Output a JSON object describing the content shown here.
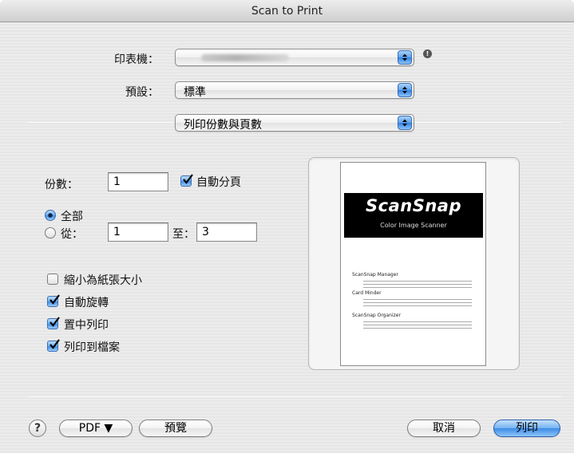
{
  "window": {
    "title": "Scan to Print"
  },
  "printer": {
    "label": "印表機：",
    "value": ""
  },
  "presets": {
    "label": "預設：",
    "value": "標準"
  },
  "section_popup": {
    "value": "列印份數與頁數"
  },
  "copies": {
    "label": "份數：",
    "value": "1",
    "collate_label": "自動分頁",
    "collate_checked": true
  },
  "pages": {
    "all_label": "全部",
    "from_label": "從：",
    "from_value": "1",
    "to_label": "至：",
    "to_value": "3",
    "selected": "all"
  },
  "options": [
    {
      "label": "縮小為紙張大小",
      "checked": false
    },
    {
      "label": "自動旋轉",
      "checked": true
    },
    {
      "label": "置中列印",
      "checked": true
    },
    {
      "label": "列印到檔案",
      "checked": true
    }
  ],
  "preview": {
    "brand": "ScanSnap",
    "subtitle": "Color Image Scanner",
    "sections": [
      "ScanSnap Manager",
      "Card Minder",
      "ScanSnap Organizer"
    ]
  },
  "buttons": {
    "help": "?",
    "pdf": "PDF ▼",
    "preview": "預覽",
    "cancel": "取消",
    "print": "列印"
  },
  "colors": {
    "accent": "#3d8ae6",
    "background": "#e9e9e9"
  }
}
